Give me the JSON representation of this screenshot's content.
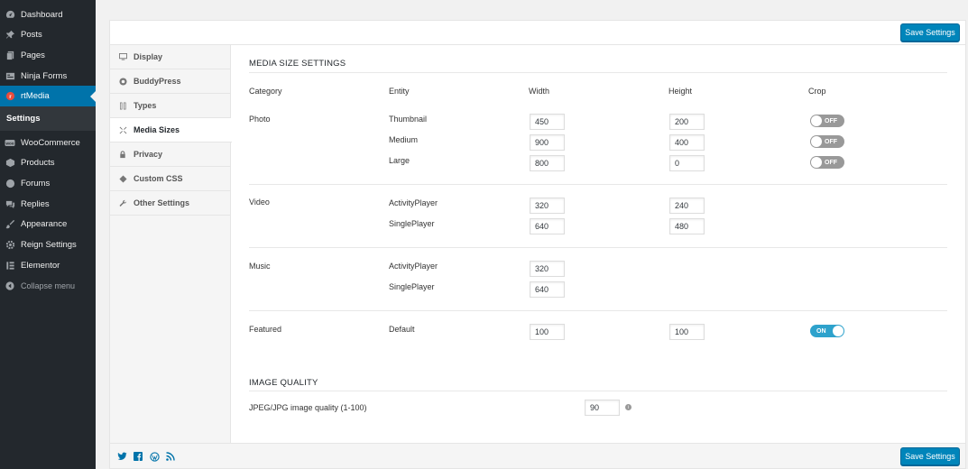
{
  "sidebar": {
    "items": [
      {
        "label": "Dashboard",
        "icon": "dashboard-icon"
      },
      {
        "label": "Posts",
        "icon": "pin-icon"
      },
      {
        "label": "Pages",
        "icon": "pages-icon"
      },
      {
        "label": "Ninja Forms",
        "icon": "forms-icon"
      },
      {
        "label": "rtMedia",
        "icon": "rtmedia-icon"
      },
      {
        "label": "WooCommerce",
        "icon": "woocommerce-icon"
      },
      {
        "label": "Products",
        "icon": "products-icon"
      },
      {
        "label": "Forums",
        "icon": "forums-icon"
      },
      {
        "label": "Replies",
        "icon": "replies-icon"
      },
      {
        "label": "Appearance",
        "icon": "appearance-icon"
      },
      {
        "label": "Reign Settings",
        "icon": "gear-icon"
      },
      {
        "label": "Elementor",
        "icon": "elementor-icon"
      },
      {
        "label": "Collapse menu",
        "icon": "collapse-icon"
      }
    ],
    "submenu_label": "Settings",
    "active_color": "#0073aa"
  },
  "toolbar": {
    "save_label": "Save Settings"
  },
  "footer": {
    "save_label": "Save Settings"
  },
  "tabs": [
    {
      "label": "Display",
      "icon": "monitor-icon"
    },
    {
      "label": "BuddyPress",
      "icon": "buddypress-icon"
    },
    {
      "label": "Types",
      "icon": "types-icon"
    },
    {
      "label": "Media Sizes",
      "icon": "media-sizes-icon"
    },
    {
      "label": "Privacy",
      "icon": "lock-icon"
    },
    {
      "label": "Custom CSS",
      "icon": "css-icon"
    },
    {
      "label": "Other Settings",
      "icon": "wrench-icon"
    }
  ],
  "media_size": {
    "title": "MEDIA SIZE SETTINGS",
    "headers": {
      "category": "Category",
      "entity": "Entity",
      "width": "Width",
      "height": "Height",
      "crop": "Crop"
    },
    "photo": {
      "category": "Photo",
      "rows": [
        {
          "entity": "Thumbnail",
          "width": "450",
          "height": "200",
          "crop": "OFF"
        },
        {
          "entity": "Medium",
          "width": "900",
          "height": "400",
          "crop": "OFF"
        },
        {
          "entity": "Large",
          "width": "800",
          "height": "0",
          "crop": "OFF"
        }
      ]
    },
    "video": {
      "category": "Video",
      "rows": [
        {
          "entity": "ActivityPlayer",
          "width": "320",
          "height": "240"
        },
        {
          "entity": "SinglePlayer",
          "width": "640",
          "height": "480"
        }
      ]
    },
    "music": {
      "category": "Music",
      "rows": [
        {
          "entity": "ActivityPlayer",
          "width": "320"
        },
        {
          "entity": "SinglePlayer",
          "width": "640"
        }
      ]
    },
    "featured": {
      "category": "Featured",
      "entity": "Default",
      "width": "100",
      "height": "100",
      "crop": "ON"
    }
  },
  "image_quality": {
    "title": "IMAGE QUALITY",
    "label": "JPEG/JPG image quality (1-100)",
    "value": "90",
    "info": "i"
  }
}
